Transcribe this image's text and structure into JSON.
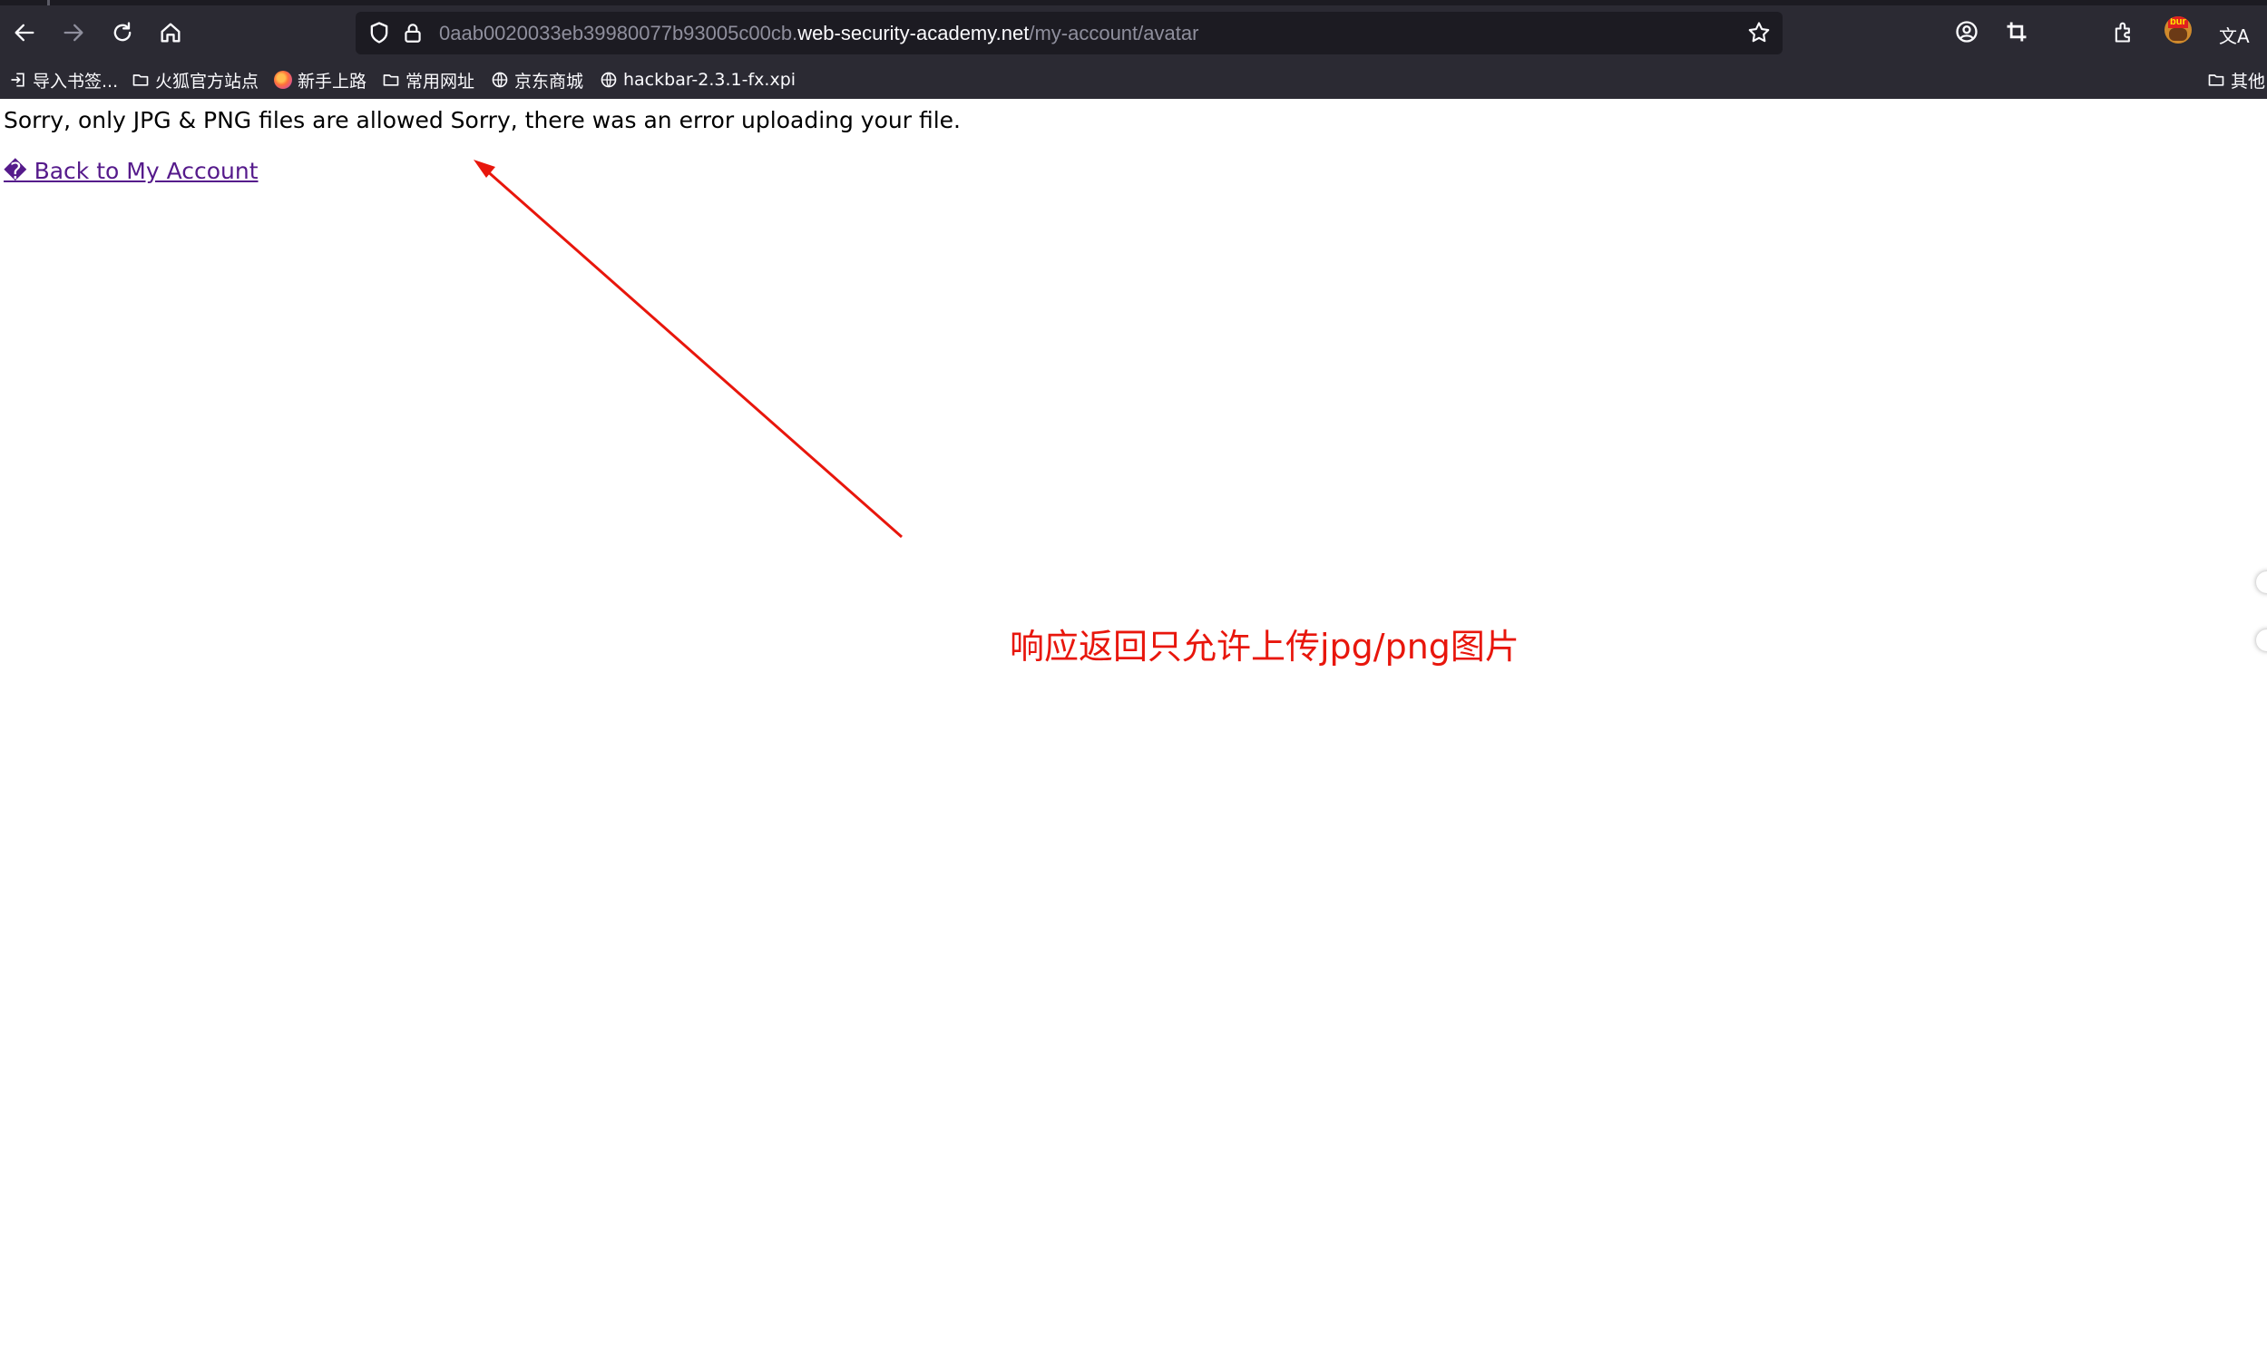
{
  "browser": {
    "url": {
      "prefix": "0aab0020033eb39980077b93005c00cb.",
      "domain": "web-security-academy.net",
      "path": "/my-account/avatar"
    },
    "nav_icons": [
      "back-arrow-icon",
      "forward-arrow-icon",
      "reload-icon",
      "home-icon"
    ],
    "toolbar_icons": [
      "account-icon",
      "crop-icon",
      "extensions-icon",
      "burp-extension-icon",
      "translate-icon"
    ],
    "translate_glyph": "文A"
  },
  "bookmarks": [
    {
      "label": "导入书签...",
      "icon": "import-icon"
    },
    {
      "label": "火狐官方站点",
      "icon": "folder-icon"
    },
    {
      "label": "新手上路",
      "icon": "firefox-icon"
    },
    {
      "label": "常用网址",
      "icon": "folder-icon"
    },
    {
      "label": "京东商城",
      "icon": "globe-icon"
    },
    {
      "label": "hackbar-2.3.1-fx.xpi",
      "icon": "globe-icon"
    },
    {
      "label": "其他",
      "icon": "folder-icon"
    }
  ],
  "page": {
    "message": "Sorry, only JPG & PNG files are allowed Sorry, there was an error uploading your file.",
    "back_link": "� Back to My Account"
  },
  "annotation": {
    "text": "响应返回只允许上传jpg/png图片",
    "color": "#e8160c"
  },
  "colors": {
    "chrome_bg": "#2b2a33",
    "urlbar_bg": "#1c1b22",
    "link_visited": "#551a8b"
  }
}
